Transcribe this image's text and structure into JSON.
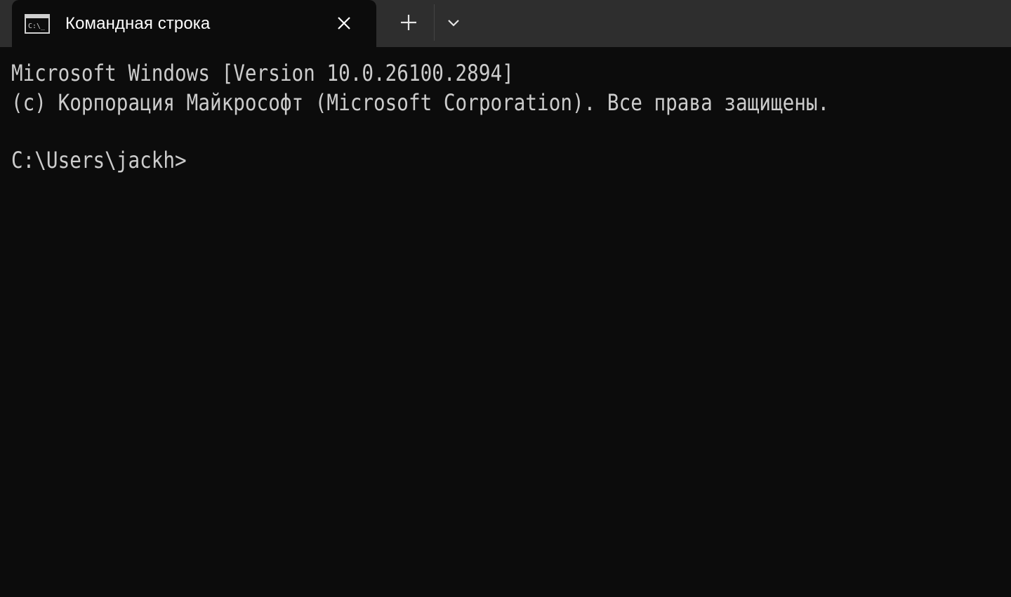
{
  "window": {
    "tab": {
      "title": "Командная строка",
      "icon": "command-prompt-icon",
      "close_icon": "close-icon"
    },
    "new_tab_icon": "plus-icon",
    "dropdown_icon": "chevron-down-icon"
  },
  "terminal": {
    "lines": [
      "Microsoft Windows [Version 10.0.26100.2894]",
      "(c) Корпорация Майкрософт (Microsoft Corporation). Все права защищены.",
      "C:\\Users\\jackh>"
    ]
  },
  "colors": {
    "background": "#0c0c0c",
    "titlebar": "#2e2e2e",
    "text": "#cccccc",
    "tab_text": "#ffffff"
  }
}
